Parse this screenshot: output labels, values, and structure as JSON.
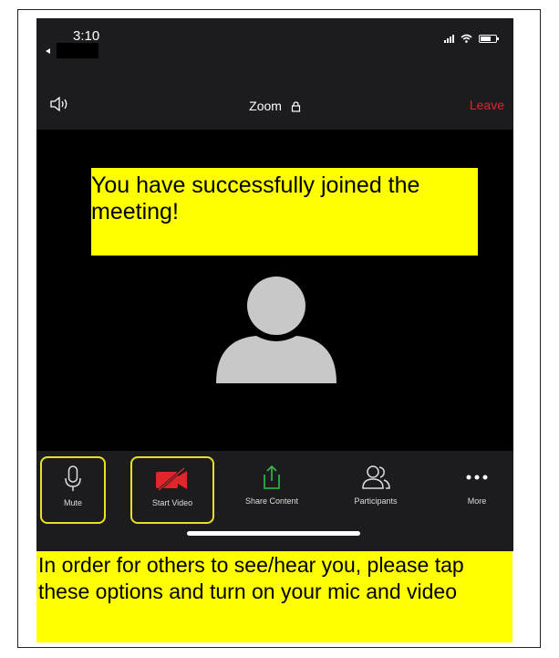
{
  "status_bar": {
    "time": "3:10"
  },
  "meeting": {
    "title": "Zoom",
    "leave_label": "Leave"
  },
  "notice": {
    "text": "You have successfully joined the meeting!"
  },
  "toolbar": {
    "items": [
      {
        "label": "Mute",
        "icon": "microphone-icon",
        "highlighted": true
      },
      {
        "label": "Start Video",
        "icon": "video-off-icon",
        "highlighted": true
      },
      {
        "label": "Share Content",
        "icon": "share-icon",
        "highlighted": false
      },
      {
        "label": "Participants",
        "icon": "participants-icon",
        "highlighted": false
      },
      {
        "label": "More",
        "icon": "more-icon",
        "highlighted": false
      }
    ]
  },
  "instruction": {
    "text": "In order for others to see/hear you, please tap these options and turn on your mic and video"
  },
  "colors": {
    "highlight": "#ffff00",
    "leave": "#e0262b",
    "share": "#2fbf4a",
    "video_off": "#e0262b"
  }
}
